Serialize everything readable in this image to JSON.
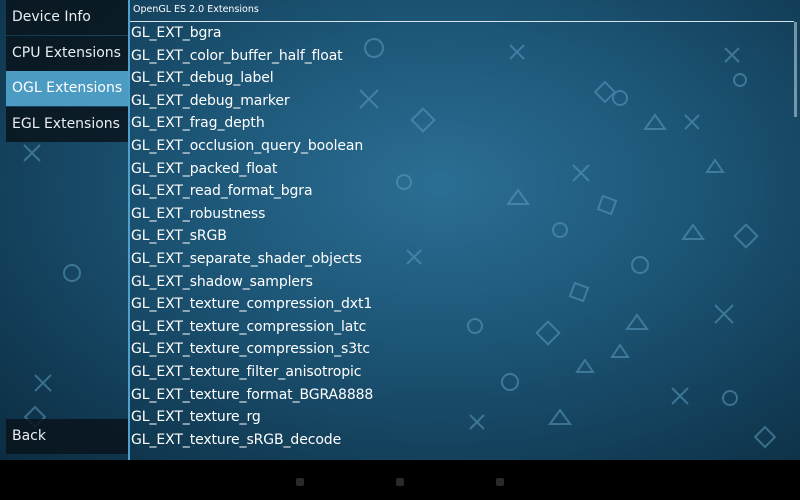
{
  "sidebar": {
    "items": [
      {
        "label": "Device Info",
        "selected": false
      },
      {
        "label": "CPU Extensions",
        "selected": false
      },
      {
        "label": "OGL Extensions",
        "selected": true
      },
      {
        "label": "EGL Extensions",
        "selected": false
      }
    ],
    "back_label": "Back"
  },
  "list": {
    "header": "OpenGL ES 2.0 Extensions",
    "items": [
      "GL_EXT_bgra",
      "GL_EXT_color_buffer_half_float",
      "GL_EXT_debug_label",
      "GL_EXT_debug_marker",
      "GL_EXT_frag_depth",
      "GL_EXT_occlusion_query_boolean",
      "GL_EXT_packed_float",
      "GL_EXT_read_format_bgra",
      "GL_EXT_robustness",
      "GL_EXT_sRGB",
      "GL_EXT_separate_shader_objects",
      "GL_EXT_shadow_samplers",
      "GL_EXT_texture_compression_dxt1",
      "GL_EXT_texture_compression_latc",
      "GL_EXT_texture_compression_s3tc",
      "GL_EXT_texture_filter_anisotropic",
      "GL_EXT_texture_format_BGRA8888",
      "GL_EXT_texture_rg",
      "GL_EXT_texture_sRGB_decode"
    ]
  },
  "colors": {
    "accent": "#4b9bc3",
    "background": "#1d5677",
    "navbar": "#000000"
  },
  "system_nav": {
    "icons": [
      "back-nav-icon",
      "home-nav-icon",
      "recents-nav-icon"
    ]
  }
}
